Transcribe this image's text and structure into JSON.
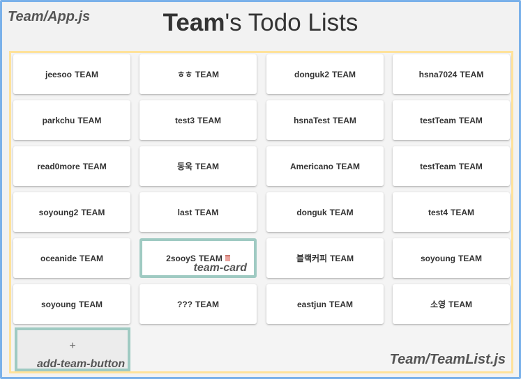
{
  "app_label": "Team/App.js",
  "title": {
    "strong": "Team",
    "rest": "'s Todo Lists"
  },
  "team_suffix": "TEAM",
  "teams": [
    "jeesoo",
    "ㅎㅎ",
    "donguk2",
    "hsna7024",
    "parkchu",
    "test3",
    "hsnaTest",
    "testTeam",
    "read0more",
    "동욱",
    "Americano",
    "testTeam",
    "soyoung2",
    "last",
    "donguk",
    "test4",
    "oceanide",
    "2sooyS",
    "블랙커피",
    "soyoung",
    "soyoung",
    "???",
    "eastjun",
    "소영"
  ],
  "highlighted_index": 17,
  "team_card_annotation": "team-card",
  "add_button": {
    "icon": "+",
    "annotation": "add-team-button"
  },
  "list_label": "Team/TeamList.js"
}
